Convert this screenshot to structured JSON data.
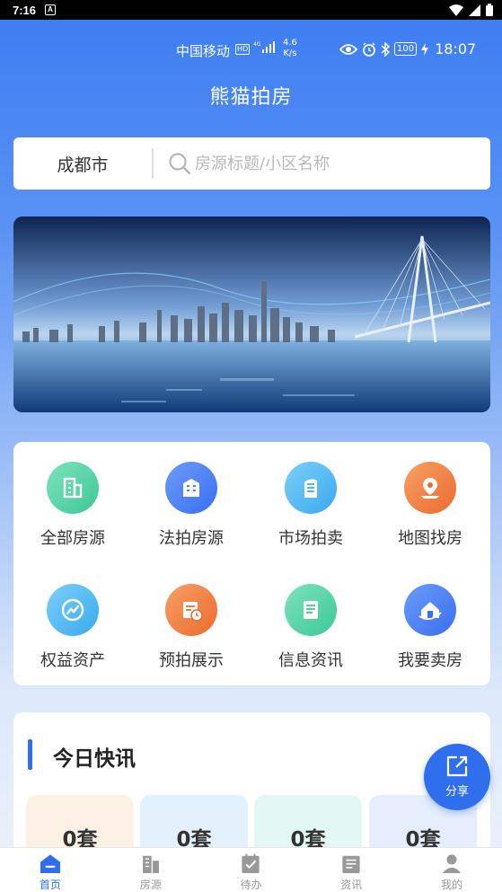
{
  "system_bar": {
    "time": "7:16"
  },
  "app_status": {
    "carrier": "中国移动",
    "hd": "HD",
    "network": "4G",
    "speed_value": "4.6",
    "speed_unit": "K/s",
    "battery": "100",
    "clock": "18:07"
  },
  "header": {
    "title": "熊猫拍房"
  },
  "search": {
    "city": "成都市",
    "placeholder": "房源标题/小区名称"
  },
  "categories": [
    {
      "label": "全部房源",
      "icon": "building-icon",
      "color": "#4fd1a5"
    },
    {
      "label": "法拍房源",
      "icon": "office-icon",
      "color": "#4c82f7"
    },
    {
      "label": "市场拍卖",
      "icon": "tower-icon",
      "color": "#4ab8f3"
    },
    {
      "label": "地图找房",
      "icon": "map-pin-icon",
      "color": "#f27a3f"
    },
    {
      "label": "权益资产",
      "icon": "chart-icon",
      "color": "#4ab8f3"
    },
    {
      "label": "预拍展示",
      "icon": "calendar-clock-icon",
      "color": "#f27a3f"
    },
    {
      "label": "信息资讯",
      "icon": "document-icon",
      "color": "#4fd1a5"
    },
    {
      "label": "我要卖房",
      "icon": "house-icon",
      "color": "#4c82f7"
    }
  ],
  "news": {
    "title": "今日快讯",
    "stats": [
      {
        "value": "0套",
        "bg": "#fdf1e6"
      },
      {
        "value": "0套",
        "bg": "#e3f1fd"
      },
      {
        "value": "0套",
        "bg": "#e3f8f2"
      },
      {
        "value": "0套",
        "bg": "#e6eefd"
      }
    ]
  },
  "share": {
    "label": "分享"
  },
  "tabs": [
    {
      "label": "首页",
      "icon": "home-icon",
      "active": true
    },
    {
      "label": "房源",
      "icon": "buildings-icon"
    },
    {
      "label": "待办",
      "icon": "checklist-icon"
    },
    {
      "label": "资讯",
      "icon": "news-icon"
    },
    {
      "label": "我的",
      "icon": "user-icon"
    }
  ]
}
